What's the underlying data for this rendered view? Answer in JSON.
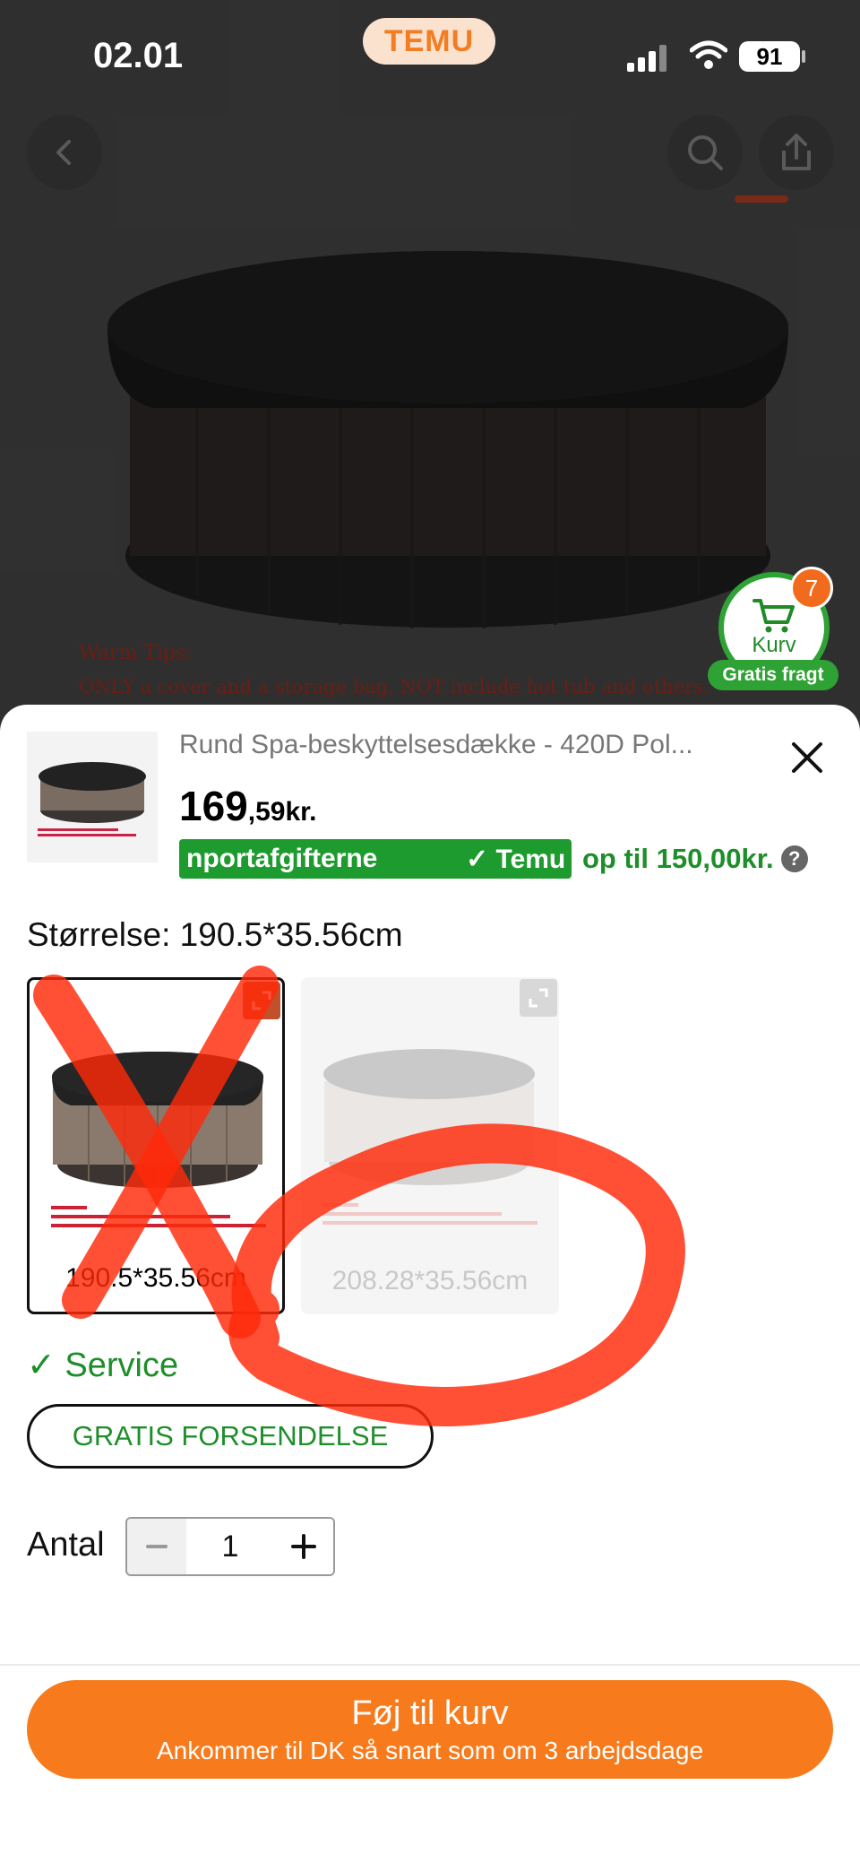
{
  "status_bar": {
    "time": "02.01",
    "app_pill": "TEMU",
    "battery": "91"
  },
  "product_image": {
    "warm_tips_title": "Warm Tips:",
    "warm_tips_text": "ONLY a cover and a storage bag, NOT include hot tub and others."
  },
  "cart": {
    "badge": "7",
    "label": "Kurv",
    "free_shipping": "Gratis fragt"
  },
  "sheet": {
    "title": "Rund Spa-beskyttelsesdække - 420D Pol...",
    "price_main": "169",
    "price_rest": ",59kr.",
    "promo_part1": "nportafgifterne",
    "promo_part2": "✓ Temu",
    "promo_limit": "op til 150,00kr.",
    "size_label": "Størrelse: 190.5*35.56cm",
    "options": [
      {
        "label": "190.5*35.56cm",
        "selected": true
      },
      {
        "label": "208.28*35.56cm",
        "selected": false
      }
    ],
    "service": "✓ Service",
    "free_shipping_button": "GRATIS FORSENDELSE",
    "quantity_label": "Antal",
    "quantity_value": "1",
    "add_to_cart": "Føj til kurv",
    "delivery_note": "Ankommer til DK så snart som om 3 arbejdsdage"
  },
  "colors": {
    "accent_orange": "#f77b1c",
    "green": "#1e9b2e",
    "annotation_red": "#ff2a0a"
  }
}
